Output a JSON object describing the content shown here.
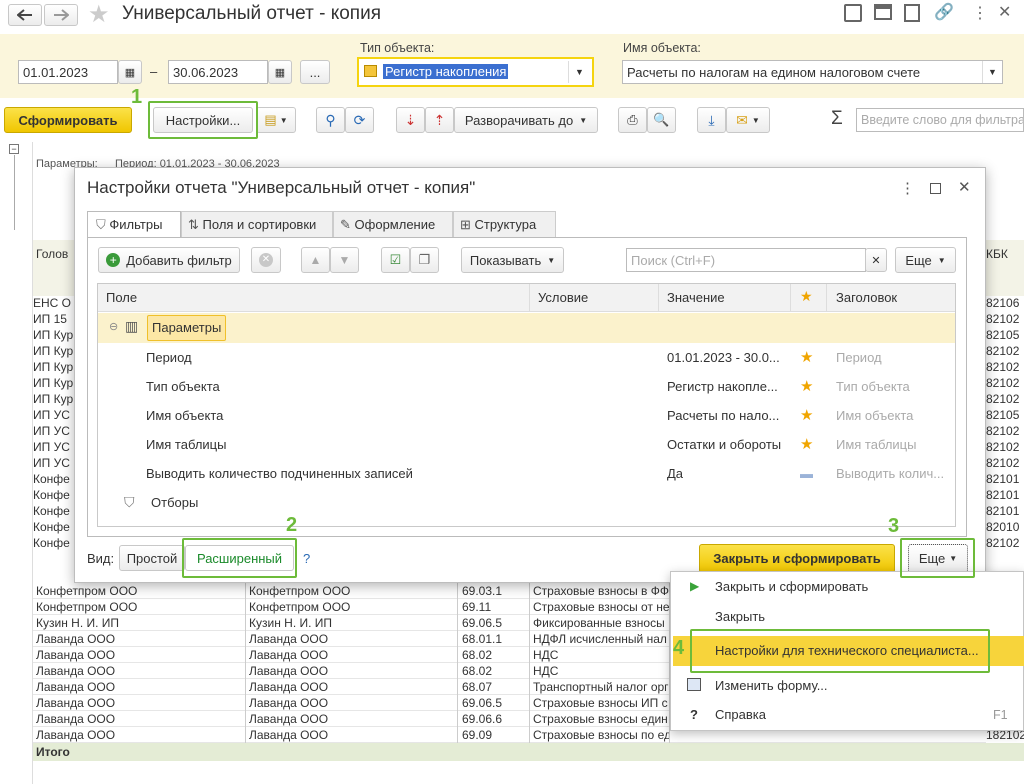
{
  "window": {
    "title": "Универсальный отчет - копия"
  },
  "filters": {
    "date_from": "01.01.2023",
    "date_to": "30.06.2023",
    "dash": "–",
    "dots": "...",
    "object_type_label": "Тип объекта:",
    "object_type_value": "Регистр накопления",
    "object_name_label": "Имя объекта:",
    "object_name_value": "Расчеты по налогам на едином налоговом счете"
  },
  "toolbar": {
    "generate": "Сформировать",
    "settings": "Настройки...",
    "expand_to": "Разворачивать до",
    "sigma": "Σ",
    "search_placeholder": "Введите слово для фильтра"
  },
  "report": {
    "params_label": "Параметры:",
    "params_value": "Период: 01.01.2023 - 30.06.2023",
    "col_head": "Голов",
    "kbk_head": "КБК",
    "left_rows": [
      "ЕНС О",
      "ИП 15",
      "ИП Кур",
      "ИП Кур",
      "ИП Кур",
      "ИП Кур",
      "ИП Кур",
      "ИП УС",
      "ИП УС",
      "ИП УС",
      "ИП УС",
      "Конфе",
      "Конфе",
      "Конфе",
      "Конфе",
      "Конфе"
    ],
    "kbk_rows": [
      "82106",
      "82102",
      "82105",
      "82102",
      "82102",
      "82102",
      "82102",
      "82105",
      "82102",
      "82102",
      "82102",
      "82101",
      "82101",
      "82101",
      "82010",
      "82102"
    ],
    "rows": [
      [
        "Конфетпром ООО",
        "Конфетпром ООО",
        "69.03.1",
        "Страховые взносы в ФФ"
      ],
      [
        "Конфетпром ООО",
        "Конфетпром ООО",
        "69.11",
        "Страховые взносы от не"
      ],
      [
        "Кузин Н. И. ИП",
        "Кузин Н. И. ИП",
        "69.06.5",
        "Фиксированные взносы"
      ],
      [
        "Лаванда ООО",
        "Лаванда ООО",
        "68.01.1",
        "НДФЛ исчисленный нал"
      ],
      [
        "Лаванда ООО",
        "Лаванда ООО",
        "68.02",
        "НДС"
      ],
      [
        "Лаванда ООО",
        "Лаванда ООО",
        "68.02",
        "НДС"
      ],
      [
        "Лаванда ООО",
        "Лаванда ООО",
        "68.07",
        "Транспортный налог орг"
      ],
      [
        "Лаванда ООО",
        "Лаванда ООО",
        "69.06.5",
        "Страховые взносы ИП с"
      ],
      [
        "Лаванда ООО",
        "Лаванда ООО",
        "69.06.6",
        "Страховые взносы един"
      ],
      [
        "Лаванда ООО",
        "Лаванда ООО",
        "69.09",
        "Страховые взносы по единому тарифу"
      ]
    ],
    "last_kbk": "182102",
    "total": "Итого"
  },
  "dialog": {
    "title": "Настройки отчета \"Универсальный отчет - копия\"",
    "tabs": [
      "Фильтры",
      "Поля и сортировки",
      "Оформление",
      "Структура"
    ],
    "add_filter": "Добавить фильтр",
    "show": "Показывать",
    "search_placeholder": "Поиск (Ctrl+F)",
    "more": "Еще",
    "columns": {
      "field": "Поле",
      "condition": "Условие",
      "value": "Значение",
      "title": "Заголовок"
    },
    "group_params": "Параметры",
    "rows": [
      {
        "field": "Период",
        "value": "01.01.2023 - 30.0...",
        "title": "Период"
      },
      {
        "field": "Тип объекта",
        "value": "Регистр накопле...",
        "title": "Тип объекта"
      },
      {
        "field": "Имя объекта",
        "value": "Расчеты по нало...",
        "title": "Имя объекта"
      },
      {
        "field": "Имя таблицы",
        "value": "Остатки и обороты",
        "title": "Имя таблицы"
      },
      {
        "field": "Выводить количество подчиненных записей",
        "value": "Да",
        "title": "Выводить колич..."
      }
    ],
    "group_filters": "Отборы",
    "view_label": "Вид:",
    "view_simple": "Простой",
    "view_advanced": "Расширенный",
    "help": "?",
    "close_generate": "Закрыть и сформировать",
    "more_btn": "Еще"
  },
  "menu": {
    "items": [
      {
        "label": "Закрыть и сформировать",
        "shortcut": ""
      },
      {
        "label": "Закрыть",
        "shortcut": ""
      },
      {
        "label": "Настройки для технического специалиста...",
        "shortcut": ""
      },
      {
        "label": "Изменить форму...",
        "shortcut": ""
      },
      {
        "label": "Справка",
        "shortcut": "F1"
      }
    ]
  },
  "annotations": [
    "1",
    "2",
    "3",
    "4"
  ],
  "colors": {
    "accent_yellow": "#f5d40f",
    "annotation_green": "#6dbb3a",
    "header_bg": "#fbf6dc"
  }
}
